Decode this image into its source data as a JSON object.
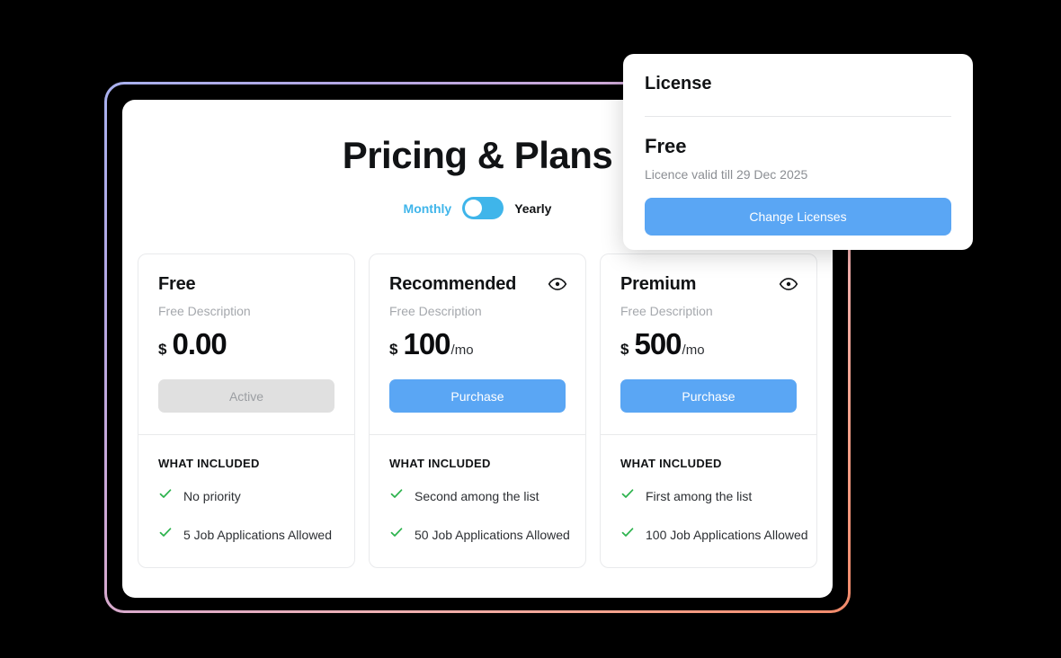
{
  "header": {
    "title": "Pricing & Plans",
    "billing": {
      "monthly_label": "Monthly",
      "yearly_label": "Yearly",
      "toggle_state": "monthly",
      "accent_color": "#3fb5ea"
    }
  },
  "plans": [
    {
      "name": "Free",
      "description": "Free Description",
      "currency": "$",
      "amount": "0.00",
      "period": "",
      "cta_label": "Active",
      "cta_state": "disabled",
      "has_eye_icon": false,
      "included_title": "WHAT INCLUDED",
      "features": [
        "No priority",
        "5 Job Applications Allowed"
      ]
    },
    {
      "name": "Recommended",
      "description": "Free Description",
      "currency": "$",
      "amount": "100",
      "period": "/mo",
      "cta_label": "Purchase",
      "cta_state": "primary",
      "has_eye_icon": true,
      "included_title": "WHAT INCLUDED",
      "features": [
        "Second among the list",
        "50 Job Applications Allowed"
      ]
    },
    {
      "name": "Premium",
      "description": "Free Description",
      "currency": "$",
      "amount": "500",
      "period": "/mo",
      "cta_label": "Purchase",
      "cta_state": "primary",
      "has_eye_icon": true,
      "included_title": "WHAT INCLUDED",
      "features": [
        "First among the list",
        "100 Job Applications Allowed"
      ]
    }
  ],
  "license_panel": {
    "title": "License",
    "plan": "Free",
    "validity": "Licence valid till 29 Dec 2025",
    "button_label": "Change Licenses",
    "button_color": "#5aa6f4"
  },
  "icons": {
    "eye": "eye-icon",
    "check": "check-icon"
  },
  "theme": {
    "primary_blue": "#5aa6f4",
    "toggle_blue": "#3fb5ea",
    "check_green": "#2bb24c",
    "frame_gradient_start": "#a9b1ee",
    "frame_gradient_end": "#f28a6a",
    "disabled_gray": "#e0e0e0"
  }
}
